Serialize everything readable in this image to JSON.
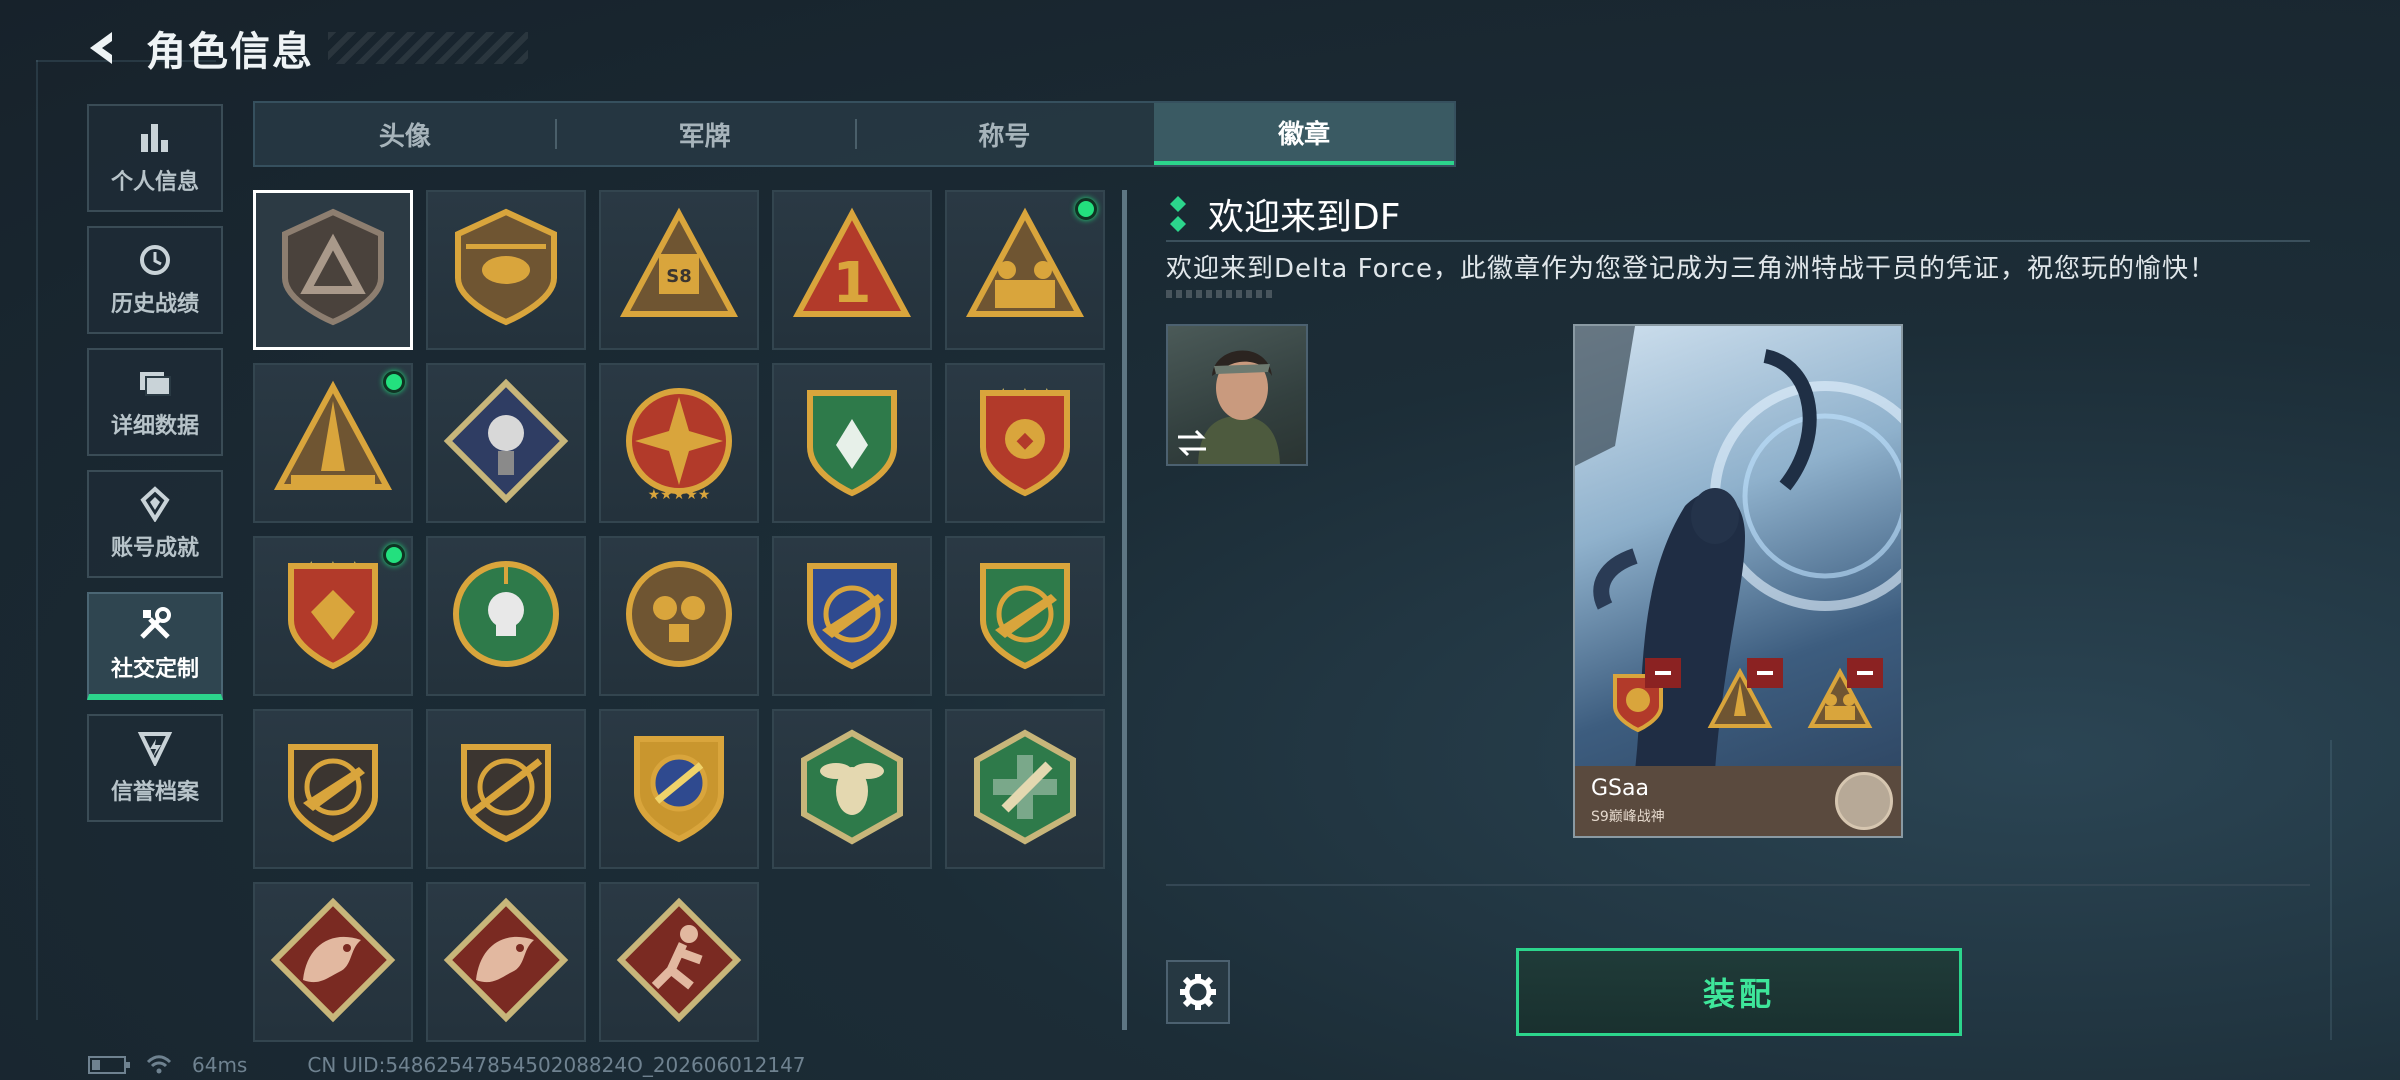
{
  "header": {
    "title": "角色信息"
  },
  "nav": {
    "items": [
      {
        "label": "个人信息",
        "icon": "bar-chart-icon"
      },
      {
        "label": "历史战绩",
        "icon": "history-icon"
      },
      {
        "label": "详细数据",
        "icon": "folder-icon"
      },
      {
        "label": "账号成就",
        "icon": "achievement-icon"
      },
      {
        "label": "社交定制",
        "icon": "tools-icon",
        "active": true
      },
      {
        "label": "信誉档案",
        "icon": "shield-bolt-icon"
      }
    ]
  },
  "tabs": [
    {
      "label": "头像"
    },
    {
      "label": "军牌"
    },
    {
      "label": "称号"
    },
    {
      "label": "徽章",
      "active": true
    }
  ],
  "badges": [
    {
      "icon": "delta-shield-badge",
      "selected": true,
      "new": false
    },
    {
      "icon": "helicopter-badge",
      "new": false
    },
    {
      "icon": "s8-truck-badge",
      "new": false
    },
    {
      "icon": "number-one-triangle-badge",
      "new": false
    },
    {
      "icon": "soldiers-triangle-badge",
      "new": true
    },
    {
      "icon": "rocket-crown-badge",
      "new": true
    },
    {
      "icon": "rose-diamond-badge",
      "new": false
    },
    {
      "icon": "star-compass-badge",
      "new": false
    },
    {
      "icon": "green-shield-star-badge",
      "new": false
    },
    {
      "icon": "red-shield-stars-badge",
      "new": false
    },
    {
      "icon": "gem-shield-stars-badge",
      "new": true
    },
    {
      "icon": "skull-crosshair-badge",
      "new": false
    },
    {
      "icon": "gasmask-circle-badge",
      "new": false
    },
    {
      "icon": "blue-rifle-crosshair-badge",
      "new": false
    },
    {
      "icon": "green-rifle-crosshair-badge",
      "new": false
    },
    {
      "icon": "rifle-circle-badge",
      "new": false
    },
    {
      "icon": "sniper-circle-badge",
      "new": false
    },
    {
      "icon": "gold-crosshair-shield-badge",
      "new": false
    },
    {
      "icon": "wasp-hexagon-badge",
      "new": false
    },
    {
      "icon": "medic-hexagon-badge",
      "new": false
    },
    {
      "icon": "dragon-diamond-badge",
      "new": false
    },
    {
      "icon": "dragon-diamond-badge-2",
      "new": false
    },
    {
      "icon": "runner-diamond-badge",
      "new": false
    }
  ],
  "detail": {
    "title": "欢迎来到DF",
    "description": "欢迎来到Delta Force，此徽章作为您登记成为三角洲特战干员的凭证，祝您玩的愉快！"
  },
  "card": {
    "player_name": "GSaa",
    "rank_title": "S9巅峰战神"
  },
  "buttons": {
    "equip": "装配"
  },
  "status": {
    "ping": "64ms",
    "uid": "CN UID:5486254785450208824O_202606012147"
  },
  "colors": {
    "accent": "#2cd58c",
    "new_dot": "#23e07e",
    "remove": "#8b2222"
  }
}
